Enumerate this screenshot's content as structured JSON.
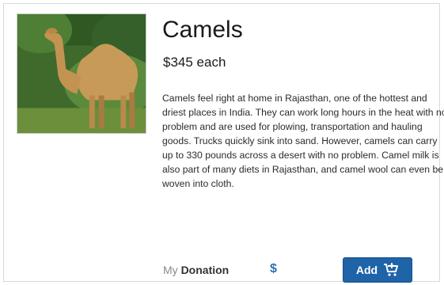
{
  "product": {
    "title": "Camels",
    "price": "$345 each",
    "description": "Camels feel right at home in Rajasthan, one of the hottest and driest places in India. They can work long hours in the heat with no problem and are used for plowing, transportation and hauling goods. Trucks quickly sink into sand. However, camels can carry up to 330 pounds across a desert with no problem. Camel milk is also part of many diets in Rajasthan, and camel wool can even be woven into cloth.",
    "image_icon": "camel-photo"
  },
  "donation": {
    "prefix": "My",
    "label": "Donation",
    "currency_symbol": "$",
    "value": ""
  },
  "add_button": {
    "label": "Add",
    "icon": "cart-icon",
    "color": "#1f63a8"
  }
}
